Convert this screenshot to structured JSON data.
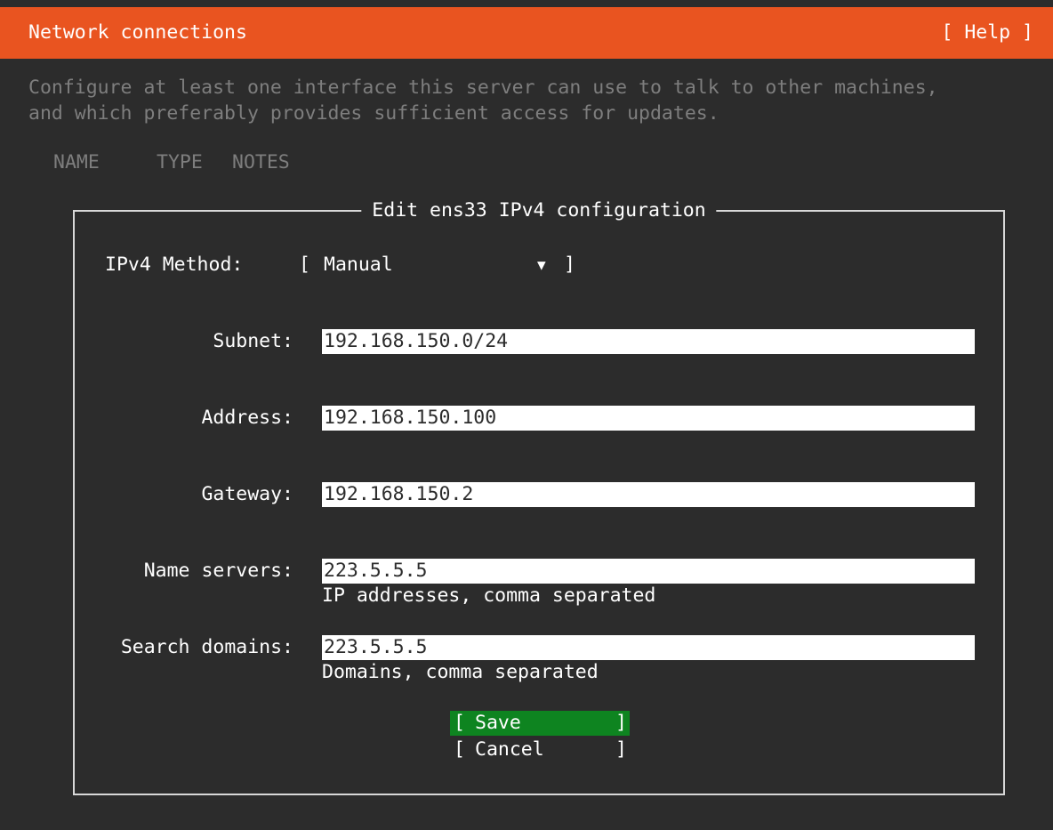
{
  "header": {
    "title": "Network connections",
    "help_label": "[ Help ]"
  },
  "intro": {
    "line1": "Configure at least one interface this server can use to talk to other machines,",
    "line2": "and which preferably provides sufficient access for updates."
  },
  "columns": {
    "name": "NAME",
    "type": "TYPE",
    "notes": "NOTES"
  },
  "dialog": {
    "title": "Edit ens33 IPv4 configuration",
    "method": {
      "label": "IPv4 Method:",
      "bracket_open": "[",
      "value": "Manual",
      "arrow": "▼",
      "bracket_close": "]"
    },
    "subnet": {
      "label": "Subnet:",
      "value": "192.168.150.0/24"
    },
    "address": {
      "label": "Address:",
      "value": "192.168.150.100"
    },
    "gateway": {
      "label": "Gateway:",
      "value": "192.168.150.2"
    },
    "name_servers": {
      "label": "Name servers:",
      "value": "223.5.5.5",
      "help": "IP addresses, comma separated"
    },
    "search_domains": {
      "label": "Search domains:",
      "value": "223.5.5.5",
      "help": "Domains, comma separated"
    },
    "buttons": {
      "bracket_open": "[",
      "bracket_close": "]",
      "save": "Save",
      "cancel": "Cancel"
    }
  },
  "colors": {
    "header_bg": "#e95420",
    "background": "#2c2c2c",
    "save_bg": "#0e8420",
    "muted_text": "#7e7e7e"
  }
}
